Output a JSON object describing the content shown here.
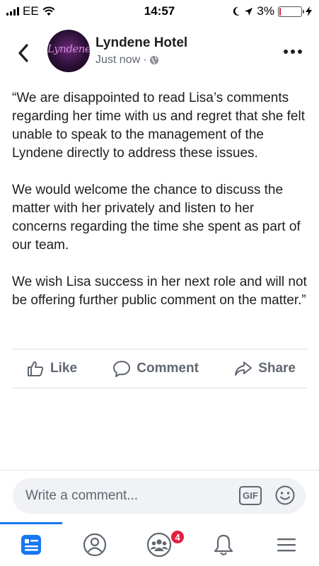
{
  "status_bar": {
    "carrier": "EE",
    "time": "14:57",
    "battery": "3%",
    "battery_level": 0.03
  },
  "post": {
    "page_name": "Lyndene Hotel",
    "avatar_text": "Lyndene",
    "time": "Just now",
    "separator": "·",
    "paragraphs": [
      "“We are disappointed to read Lisa’s comments regarding her time with us and regret that she felt unable to speak to the management of the Lyndene directly to address these issues.",
      "We would welcome the chance to discuss the matter with her privately and listen to her concerns regarding the time she spent as part of our team.",
      "We wish Lisa success in her next role and will not be offering further public comment on the matter.”"
    ]
  },
  "actions": {
    "like": "Like",
    "comment": "Comment",
    "share": "Share"
  },
  "composer": {
    "placeholder": "Write a comment...",
    "gif": "GIF"
  },
  "tabbar": {
    "notifications_badge": "4"
  },
  "icons": [
    "back-icon",
    "globe-icon",
    "more-icon",
    "like-icon",
    "comment-icon",
    "share-icon",
    "emoji-icon",
    "news-feed-icon",
    "profile-icon",
    "groups-icon",
    "bell-icon",
    "menu-icon"
  ],
  "colors": {
    "accent": "#1877f2",
    "badge": "#e41e3f",
    "muted_text": "#606770"
  }
}
